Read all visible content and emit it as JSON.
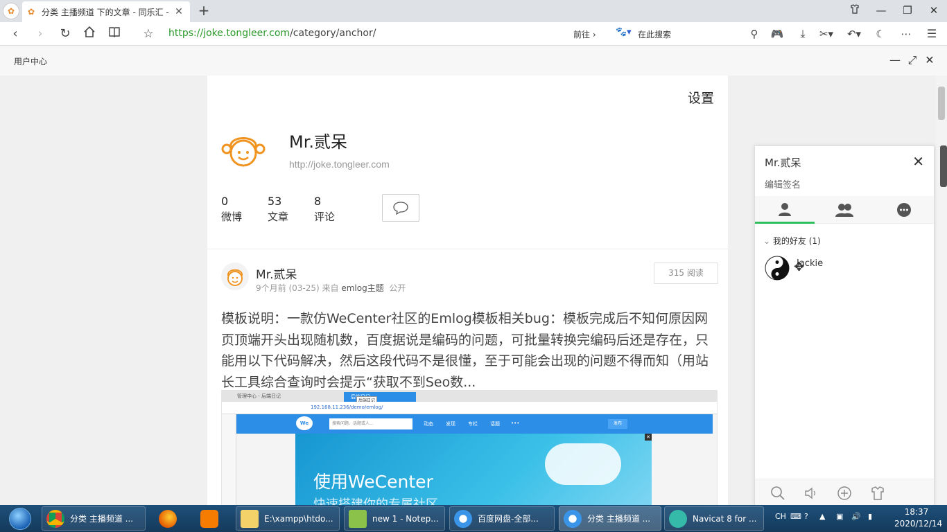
{
  "browser": {
    "tab_title": "分类 主播频道 下的文章 - 同乐汇 -",
    "url_scheme": "https://",
    "url_host": "joke.tongleer.com",
    "url_path": "/category/anchor/",
    "goto_label": "前往",
    "search_placeholder": "在此搜索"
  },
  "subbar": {
    "label": "用户中心"
  },
  "profile": {
    "settings_label": "设置",
    "name": "Mr.贰呆",
    "url": "http://joke.tongleer.com",
    "stats": [
      {
        "num": "0",
        "label": "微博"
      },
      {
        "num": "53",
        "label": "文章"
      },
      {
        "num": "8",
        "label": "评论"
      }
    ]
  },
  "post": {
    "author": "Mr.贰呆",
    "meta_time": "9个月前 (03-25) 来自",
    "meta_source": "emlog主题",
    "meta_visibility": "公开",
    "reads": "315 阅读",
    "text": "模板说明：一款仿WeCenter社区的Emlog模板相关bug：模板完成后不知何原因网页顶端开头出现随机数，百度据说是编码的问题，可批量转换完编码后还是存在，只能用以下代码解决，然后这段代码不是很懂，至于可能会出现的问题不得而知（用站长工具综合查询时会提示“获取不到Seo数..."
  },
  "embed": {
    "tab_other": "管理中心 - 后端日记",
    "tab_active": "后端日记",
    "tooltip": "后端日记",
    "url": "192.168.11.236/demo/emlog/",
    "logo": "We",
    "search_placeholder": "搜索问题、话题或人...",
    "nav": [
      "动态",
      "发现",
      "专栏",
      "话题",
      "•••"
    ],
    "publish": "发布",
    "banner_title": "使用WeCenter",
    "banner_sub": "快速搭建你的专属社区"
  },
  "chat": {
    "name": "Mr.贰呆",
    "sign": "编辑签名",
    "group": "我的好友 (1)",
    "friend": "Jackie"
  },
  "taskbar": {
    "items": [
      "分类 主播频道 ...",
      "E:\\xampp\\htdo...",
      "new 1 - Notep...",
      "百度网盘-全部...",
      "分类 主播频道 ...",
      "Navicat 8 for ..."
    ],
    "lang": "CH",
    "time": "18:37",
    "date": "2020/12/14"
  },
  "colors": {
    "accent_green": "#2dbe60",
    "url_green": "#2a9a2a",
    "brand_orange": "#f0931f",
    "wecenter_blue": "#2d8ee8"
  }
}
